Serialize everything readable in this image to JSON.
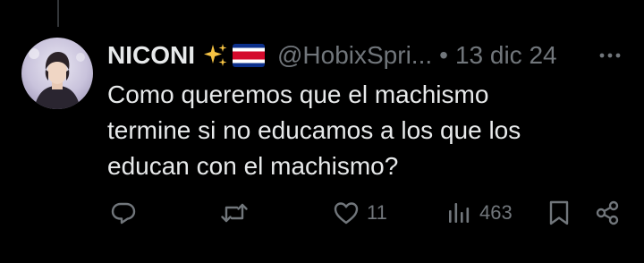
{
  "tweet": {
    "display_name": "NICONI",
    "name_emojis": [
      "sparkles-emoji",
      "costa-rica-flag-emoji"
    ],
    "handle": "@HobixSpri...",
    "separator": "•",
    "date": "13 dic 24",
    "text_lines": [
      "Como queremos que el machismo",
      "termine si no educamos a los que los",
      "educan con el machismo?"
    ]
  },
  "actions": {
    "reply": {
      "icon": "reply-icon",
      "count": ""
    },
    "retweet": {
      "icon": "retweet-icon",
      "count": ""
    },
    "like": {
      "icon": "heart-icon",
      "count": "11"
    },
    "views": {
      "icon": "views-icon",
      "count": "463"
    },
    "bookmark": {
      "icon": "bookmark-icon"
    },
    "share": {
      "icon": "share-icon"
    }
  },
  "colors": {
    "background": "#000000",
    "text": "#e7e9ea",
    "secondary": "#71767b",
    "thread_line": "#333639",
    "flag_blue": "#0b2f8a",
    "flag_red": "#d40a2c",
    "sparkle_yellow": "#f6c343"
  }
}
